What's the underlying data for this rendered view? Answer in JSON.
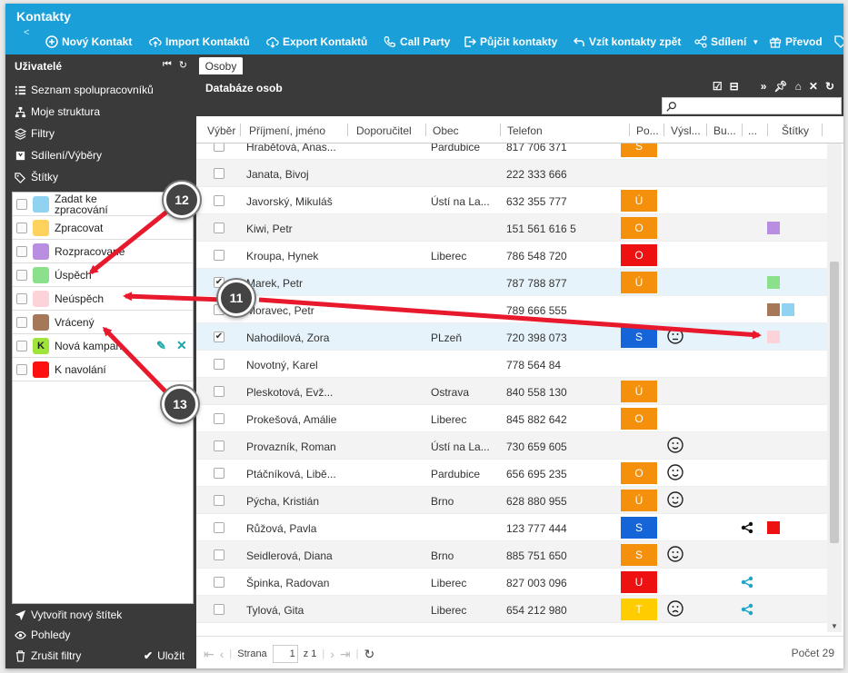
{
  "app": {
    "title": "Kontakty"
  },
  "toolbar": {
    "collapse": "<",
    "new_contact": "Nový Kontakt",
    "import": "Import Kontaktů",
    "export": "Export Kontaktů",
    "call_party": "Call Party",
    "lend": "Půjčit kontakty",
    "take_back": "Vzít kontakty zpět",
    "share": "Sdílení",
    "transfer": "Převod"
  },
  "sidebar": {
    "header": "Uživatelé",
    "items": [
      "Seznam spolupracovníků",
      "Moje struktura",
      "Filtry",
      "Sdílení/Výběry",
      "Štítky"
    ],
    "tags": [
      {
        "label": "Zadat ke zpracování",
        "color": "#8fd3f1",
        "letter": ""
      },
      {
        "label": "Zpracovat",
        "color": "#ffd25e",
        "letter": ""
      },
      {
        "label": "Rozpracované",
        "color": "#b98de0",
        "letter": ""
      },
      {
        "label": "Úspěch",
        "color": "#8be08b",
        "letter": ""
      },
      {
        "label": "Neúspěch",
        "color": "#fcd3d8",
        "letter": ""
      },
      {
        "label": "Vrácený",
        "color": "#a5785a",
        "letter": ""
      },
      {
        "label": "Nová kampaň",
        "color": "#9ee43a",
        "letter": "K"
      },
      {
        "label": "K navolání",
        "color": "#ff1010",
        "letter": ""
      }
    ],
    "create_tag": "Vytvořit nový štítek",
    "views": "Pohledy",
    "cancel_filters": "Zrušit filtry",
    "save": "Uložit"
  },
  "main": {
    "tab": "Osoby",
    "title": "Databáze osob",
    "columns": [
      "Výběr",
      "Příjmení, jméno",
      "Doporučitel",
      "Obec",
      "Telefon",
      "Po...",
      "Výsl...",
      "Bu...",
      "...",
      "Štítky"
    ],
    "rows": [
      {
        "name": "Hrabětová, Anas...",
        "city": "Pardubice",
        "phone": "817 706 371",
        "badge": "S",
        "badge_color": "#f5900c",
        "checked": false,
        "smiley": "",
        "share": "",
        "tags": []
      },
      {
        "name": "Janata, Bivoj",
        "city": "",
        "phone": "222 333 666",
        "badge": "",
        "badge_color": "",
        "checked": false,
        "smiley": "",
        "share": "",
        "tags": []
      },
      {
        "name": "Javorský, Mikuláš",
        "city": "Ústí na La...",
        "phone": "632 355 777",
        "badge": "Ú",
        "badge_color": "#f5900c",
        "checked": false,
        "smiley": "",
        "share": "",
        "tags": []
      },
      {
        "name": "Kiwi, Petr",
        "city": "",
        "phone": "151 561 616 5",
        "badge": "O",
        "badge_color": "#f5900c",
        "checked": false,
        "smiley": "",
        "share": "",
        "tags": [
          "#b98de0"
        ]
      },
      {
        "name": "Kroupa, Hynek",
        "city": "Liberec",
        "phone": "786 548 720",
        "badge": "O",
        "badge_color": "#ee1111",
        "checked": false,
        "smiley": "",
        "share": "",
        "tags": []
      },
      {
        "name": "Marek, Petr",
        "city": "",
        "phone": "787 788 877",
        "badge": "Ú",
        "badge_color": "#f5900c",
        "checked": true,
        "smiley": "",
        "share": "",
        "tags": [
          "#8be08b"
        ]
      },
      {
        "name": "Moravec, Petr",
        "city": "",
        "phone": "789 666 555",
        "badge": "",
        "badge_color": "",
        "checked": false,
        "smiley": "",
        "share": "",
        "tags": [
          "#a5785a",
          "#8fd3f1"
        ]
      },
      {
        "name": "Nahodilová, Zora",
        "city": "PLzeň",
        "phone": "720 398 073",
        "badge": "S",
        "badge_color": "#1565d8",
        "checked": true,
        "smiley": "neutral",
        "share": "",
        "tags": [
          "#fcd3d8"
        ]
      },
      {
        "name": "Novotný, Karel",
        "city": "",
        "phone": "778 564 84",
        "badge": "",
        "badge_color": "",
        "checked": false,
        "smiley": "",
        "share": "",
        "tags": []
      },
      {
        "name": "Pleskotová, Evž...",
        "city": "Ostrava",
        "phone": "840 558 130",
        "badge": "Ú",
        "badge_color": "#f5900c",
        "checked": false,
        "smiley": "",
        "share": "",
        "tags": []
      },
      {
        "name": "Prokešová, Amálie",
        "city": "Liberec",
        "phone": "845 882 642",
        "badge": "O",
        "badge_color": "#f5900c",
        "checked": false,
        "smiley": "",
        "share": "",
        "tags": []
      },
      {
        "name": "Provazník, Roman",
        "city": "Ústí na La...",
        "phone": "730 659 605",
        "badge": "",
        "badge_color": "",
        "checked": false,
        "smiley": "happy",
        "share": "",
        "tags": []
      },
      {
        "name": "Ptáčníková, Libě...",
        "city": "Pardubice",
        "phone": "656 695 235",
        "badge": "O",
        "badge_color": "#f5900c",
        "checked": false,
        "smiley": "happy",
        "share": "",
        "tags": []
      },
      {
        "name": "Pýcha, Kristián",
        "city": "Brno",
        "phone": "628 880 955",
        "badge": "Ú",
        "badge_color": "#f5900c",
        "checked": false,
        "smiley": "happy",
        "share": "",
        "tags": []
      },
      {
        "name": "Růžová, Pavla",
        "city": "",
        "phone": "123 777 444",
        "badge": "S",
        "badge_color": "#1565d8",
        "checked": false,
        "smiley": "",
        "share": "#111111",
        "tags": [
          "#ee1111"
        ]
      },
      {
        "name": "Seidlerová, Diana",
        "city": "Brno",
        "phone": "885 751 650",
        "badge": "S",
        "badge_color": "#f5900c",
        "checked": false,
        "smiley": "happy",
        "share": "",
        "tags": []
      },
      {
        "name": "Špinka, Radovan",
        "city": "Liberec",
        "phone": "827 003 096",
        "badge": "U",
        "badge_color": "#ee1111",
        "checked": false,
        "smiley": "",
        "share": "#1ba6c9",
        "tags": []
      },
      {
        "name": "Tylová, Gita",
        "city": "Liberec",
        "phone": "654 212 980",
        "badge": "T",
        "badge_color": "#ffcc00",
        "checked": false,
        "smiley": "sad",
        "share": "#1ba6c9",
        "tags": []
      }
    ],
    "pager": {
      "page_label": "Strana",
      "page": "1",
      "of": "z 1"
    },
    "count": "Počet 29"
  },
  "callouts": [
    "12",
    "11",
    "13"
  ],
  "colors": {
    "accent": "#1a9fd8",
    "sidebar_bg": "#3a3a3a",
    "arrow": "#e8192c"
  }
}
